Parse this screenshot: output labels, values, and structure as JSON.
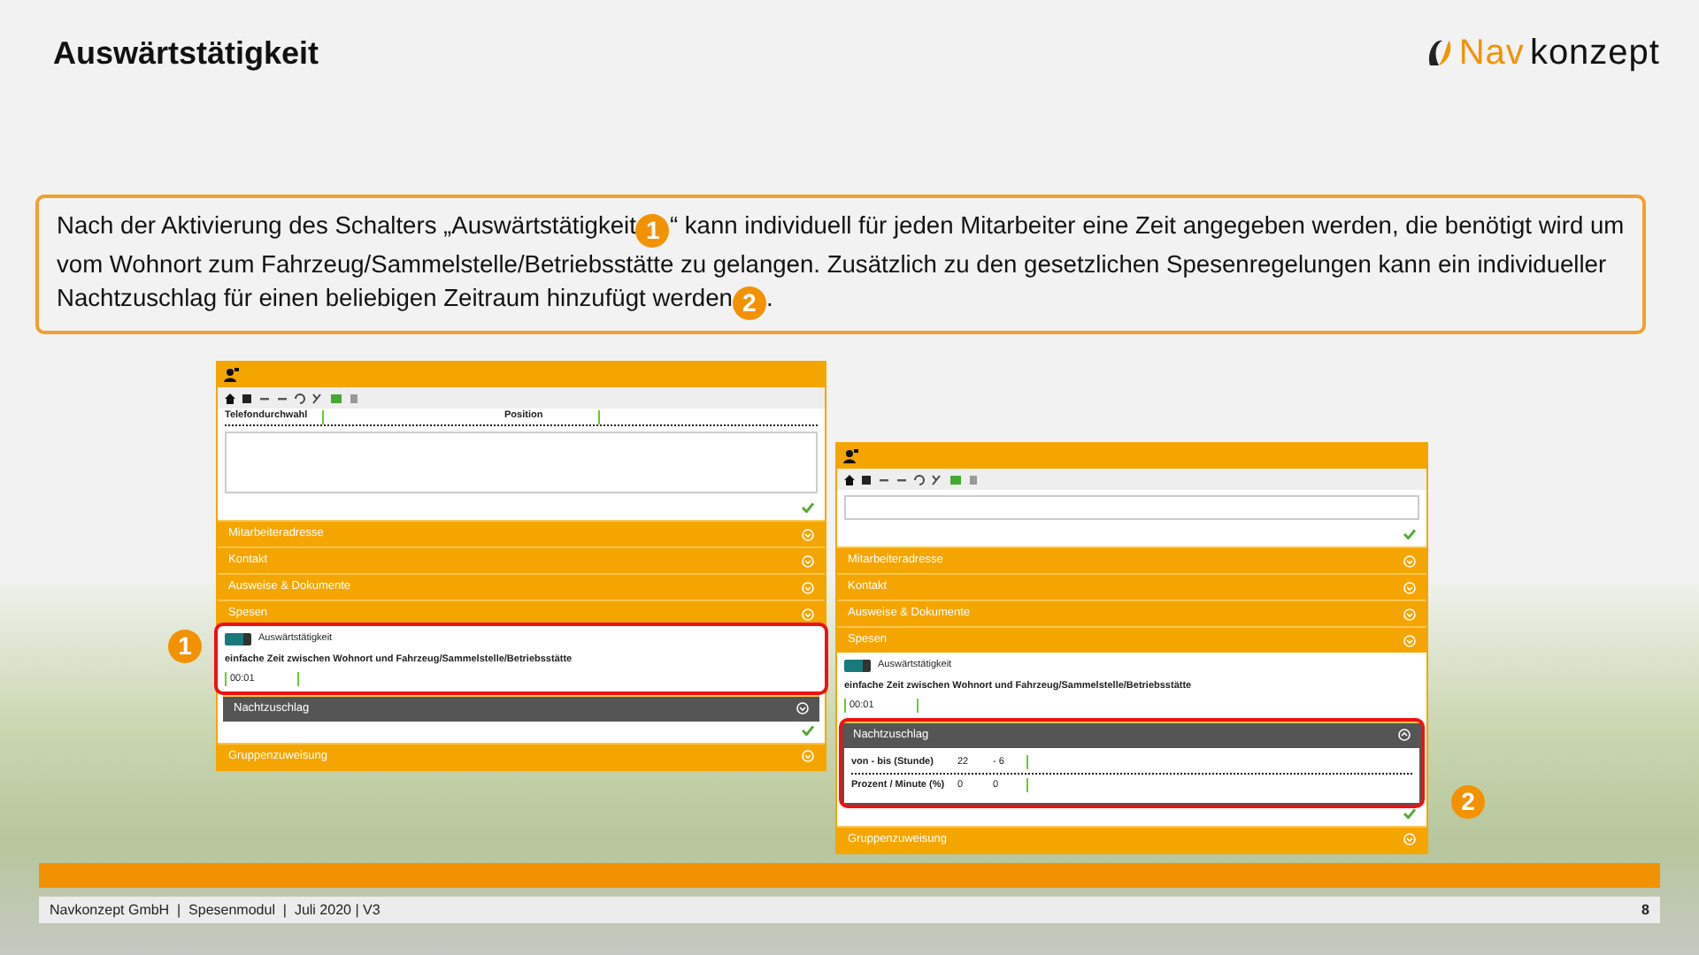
{
  "title": "Auswärtstätigkeit",
  "logo": {
    "part_1": "Nav",
    "part_2": "konzept"
  },
  "description": [
    {
      "kind": "text",
      "text": "Nach der Aktivierung des Schalters „Auswärtstätigkeit"
    },
    {
      "kind": "marker",
      "text": "1"
    },
    {
      "kind": "text",
      "text": "“ kann individuell für jeden Mitarbeiter eine Zeit angegeben werden, die benötigt wird um vom Wohnort zum Fahrzeug/Sammelstelle/Betriebsstätte zu gelangen. Zusätzlich zu den gesetzlichen Spesenregelungen kann ein individueller Nachtzuschlag für einen beliebigen Zeitraum hinzufügt werden"
    },
    {
      "kind": "marker",
      "text": "2"
    },
    {
      "kind": "text",
      "text": "."
    }
  ],
  "screenshots": [
    {
      "form_rows": [
        {
          "label": "Telefondurchwahl",
          "label_2": "Position"
        }
      ],
      "accordions": [
        "Mitarbeiteradresse",
        "Kontakt",
        "Ausweise & Dokumente",
        "Spesen"
      ],
      "spesen": {
        "toggle_label": "Auswärtstätigkeit",
        "toggle_on": true,
        "time_label": "einfache Zeit zwischen Wohnort und Fahrzeug/Sammelstelle/Betriebsstätte",
        "time_value": "00:01",
        "highlighted": true,
        "callout": "1"
      },
      "night": {
        "title": "Nachtzuschlag",
        "expanded": false
      },
      "last_accordion": "Gruppenzuweisung"
    },
    {
      "accordions": [
        "Mitarbeiteradresse",
        "Kontakt",
        "Ausweise & Dokumente",
        "Spesen"
      ],
      "spesen": {
        "toggle_label": "Auswärtstätigkeit",
        "toggle_on": true,
        "time_label": "einfache Zeit zwischen Wohnort und Fahrzeug/Sammelstelle/Betriebsstätte",
        "time_value": "00:01"
      },
      "night": {
        "title": "Nachtzuschlag",
        "expanded": true,
        "highlighted": true,
        "callout": "2",
        "rows": [
          {
            "label": "von - bis (Stunde)",
            "value_1": "22",
            "value_2": "- 6"
          },
          {
            "label": "Prozent / Minute (%)",
            "value_1": "0",
            "value_2": "0"
          }
        ]
      },
      "last_accordion": "Gruppenzuweisung"
    }
  ],
  "footer": {
    "text": "Navkonzept GmbH  |  Spesenmodul  |  Juli 2020 | V3",
    "page": "8"
  }
}
